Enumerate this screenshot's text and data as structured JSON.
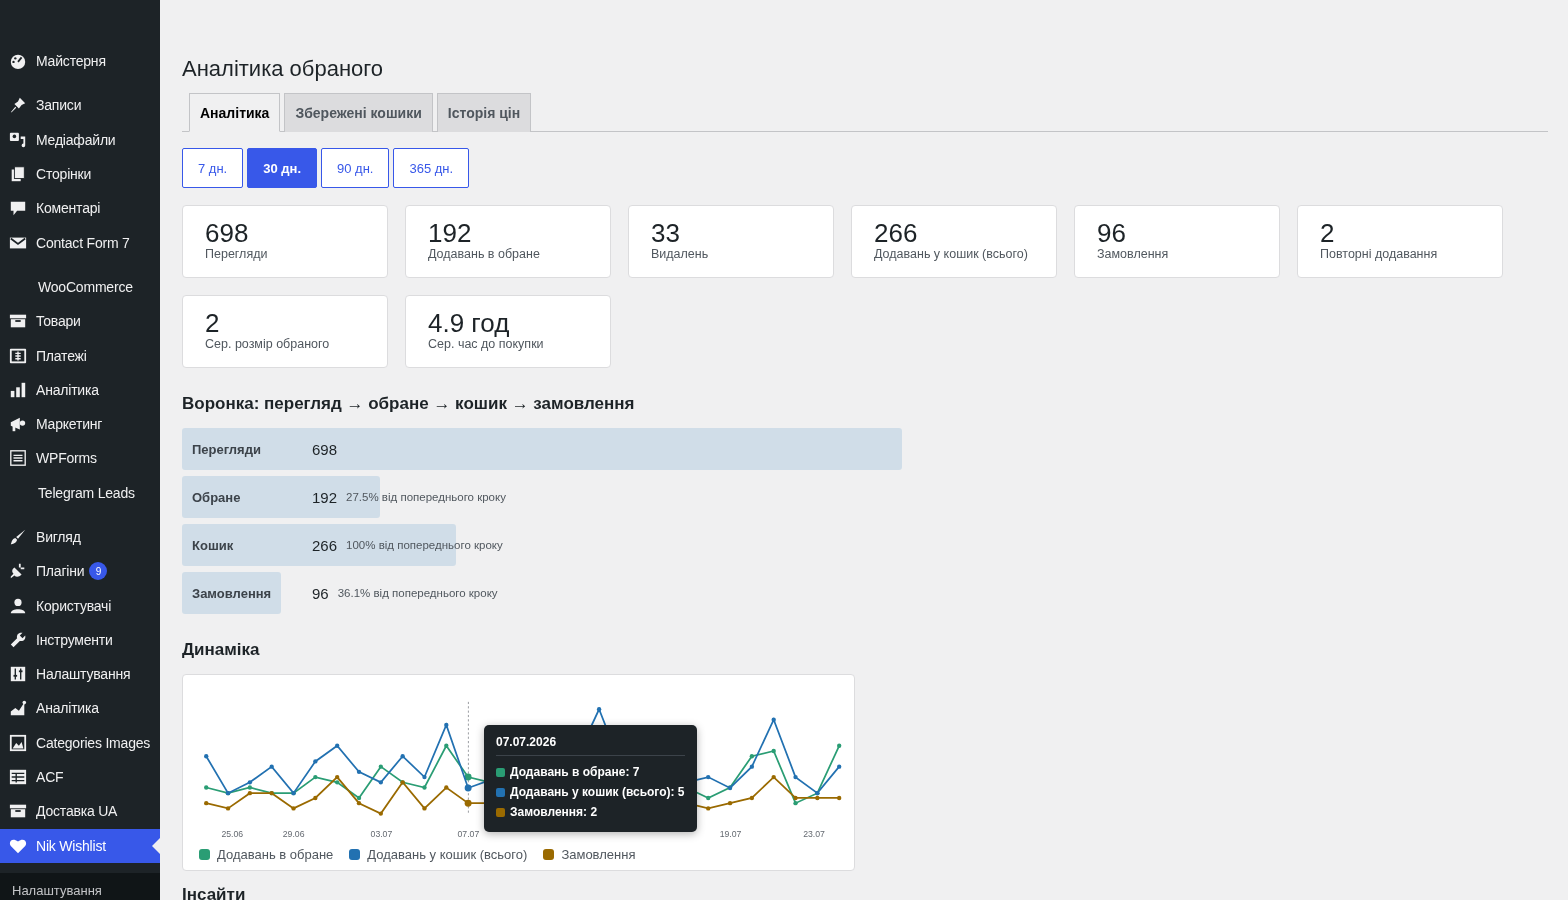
{
  "sidebar": {
    "groups": [
      [
        {
          "label": "Майстерня",
          "selected": false
        }
      ],
      [
        {
          "label": "Записи",
          "selected": false
        },
        {
          "label": "Медіафайли",
          "selected": false
        },
        {
          "label": "Сторінки",
          "selected": false
        },
        {
          "label": "Коментарі",
          "selected": false
        },
        {
          "label": "Contact Form 7",
          "selected": false
        }
      ],
      [
        {
          "label": "WooCommerce",
          "selected": false
        },
        {
          "label": "Товари",
          "selected": false
        },
        {
          "label": "Платежі",
          "selected": false
        },
        {
          "label": "Аналітика",
          "selected": false
        },
        {
          "label": "Маркетинг",
          "selected": false
        },
        {
          "label": "WPForms",
          "selected": false
        },
        {
          "label": "Telegram Leads",
          "selected": false
        }
      ],
      [
        {
          "label": "Вигляд",
          "selected": false
        },
        {
          "label": "Плагіни",
          "badge": "9",
          "selected": false
        },
        {
          "label": "Користувачі",
          "selected": false
        },
        {
          "label": "Інструменти",
          "selected": false
        },
        {
          "label": "Налаштування",
          "selected": false
        },
        {
          "label": "Аналітика",
          "selected": false
        },
        {
          "label": "Categories Images",
          "selected": false
        },
        {
          "label": "ACF",
          "selected": false
        },
        {
          "label": "Доставка UA",
          "selected": false
        },
        {
          "label": "Nik Wishlist",
          "selected": true
        }
      ]
    ],
    "submenu": [
      "Налаштування"
    ]
  },
  "page": {
    "title": "Аналітика обраного"
  },
  "tabs": [
    {
      "label": "Аналітика",
      "selected": true
    },
    {
      "label": "Збережені кошики",
      "selected": false
    },
    {
      "label": "Історія цін",
      "selected": false
    }
  ],
  "periods": [
    {
      "label": "7 дн.",
      "selected": false
    },
    {
      "label": "30 дн.",
      "selected": true
    },
    {
      "label": "90 дн.",
      "selected": false
    },
    {
      "label": "365 дн.",
      "selected": false
    }
  ],
  "stats": [
    {
      "value": "698",
      "label": "Перегляди"
    },
    {
      "value": "192",
      "label": "Додавань в обране"
    },
    {
      "value": "33",
      "label": "Видалень"
    },
    {
      "value": "266",
      "label": "Додавань у кошик (всього)"
    },
    {
      "value": "96",
      "label": "Замовлення"
    },
    {
      "value": "2",
      "label": "Повторні додавання"
    },
    {
      "value": "2",
      "label": "Сер. розмір обраного"
    },
    {
      "value": "4.9 год",
      "label": "Сер. час до покупки"
    }
  ],
  "funnel": {
    "title": "Воронка: перегляд → обране → кошик → замовлення",
    "rows": [
      {
        "label": "Перегляди",
        "value": "698"
      },
      {
        "label": "Обране",
        "value": "192",
        "note": "27.5% від попереднього кроку"
      },
      {
        "label": "Кошик",
        "value": "266",
        "note": "100% від попереднього кроку"
      },
      {
        "label": "Замовлення",
        "value": "96",
        "note": "36.1% від попереднього кроку"
      }
    ]
  },
  "dynamics": {
    "title": "Динаміка",
    "x_labels": [
      "25.06",
      "29.06",
      "03.07",
      "07.07",
      "19.07",
      "23.07"
    ],
    "series": [
      {
        "name": "Додавань в обране",
        "color": "#2a9d74"
      },
      {
        "name": "Додавань у кошик (всього)",
        "color": "#2271b1"
      },
      {
        "name": "Замовлення",
        "color": "#9a6a00"
      }
    ],
    "tooltip": {
      "title": "07.07.2026",
      "rows": [
        {
          "text": "Додавань в обране: 7",
          "color": "#2a9d74"
        },
        {
          "text": "Додавань у кошик (всього): 5",
          "color": "#2271b1"
        },
        {
          "text": "Замовлення: 2",
          "color": "#9a6a00"
        }
      ]
    }
  },
  "insights": {
    "title": "Інсайти"
  }
}
